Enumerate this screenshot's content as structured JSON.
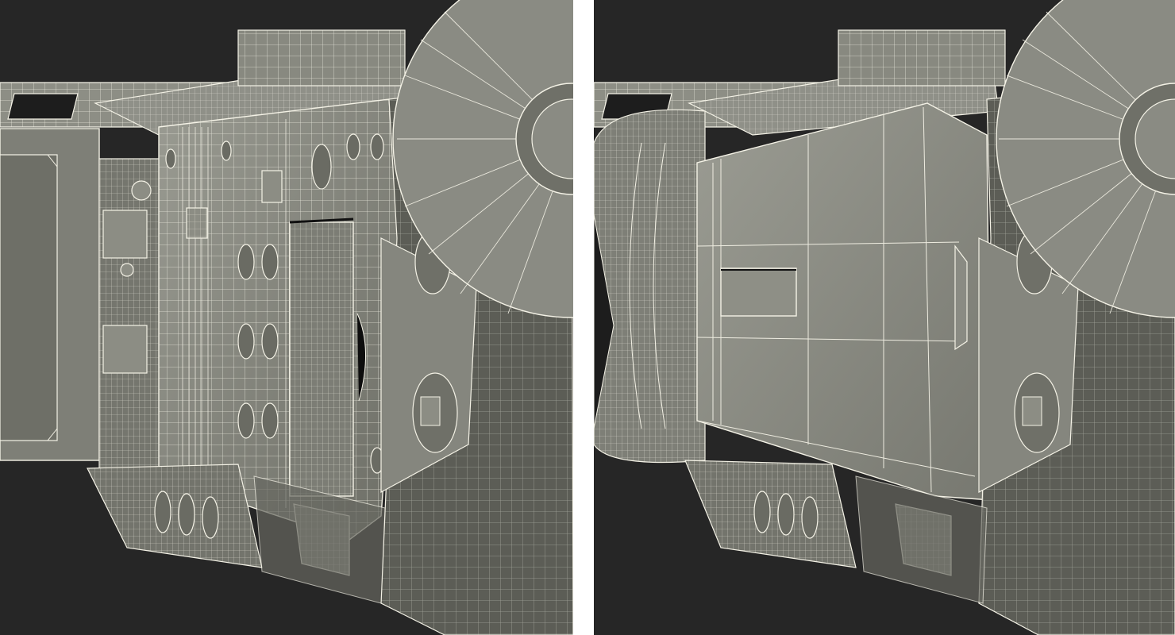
{
  "scene": {
    "panels": [
      {
        "view": "wireframe-side-open"
      },
      {
        "view": "wireframe-side-closed"
      }
    ]
  },
  "colors": {
    "background": "#262626",
    "divider": "#ffffff",
    "surface_light": "#8e8f86",
    "surface_mid": "#7a7b72",
    "surface_dark": "#63645c",
    "wire": "#f4f2e6",
    "hole": "#111111"
  }
}
